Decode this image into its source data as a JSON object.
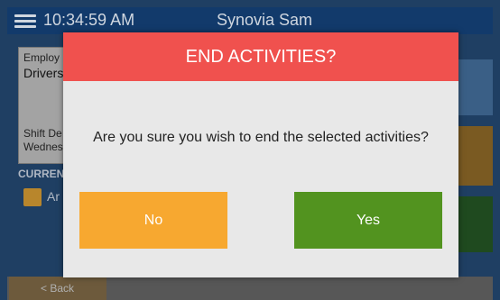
{
  "header": {
    "time": "10:34:59 AM",
    "user": "Synovia Sam"
  },
  "info_panel": {
    "employee_label": "Employ",
    "employee_value": "Drivers",
    "shift_label": "Shift De",
    "shift_value": "Wednes"
  },
  "current": {
    "label": "CURREN",
    "activity_text": "Ar"
  },
  "footer": {
    "back_label": "< Back"
  },
  "dialog": {
    "title": "END ACTIVITIES?",
    "message": "Are you sure you wish to end the selected activities?",
    "no_label": "No",
    "yes_label": "Yes"
  },
  "colors": {
    "dialog_header": "#f0514e",
    "no_button": "#f7a830",
    "yes_button": "#52931f",
    "app_background": "#1f3f63"
  },
  "icons": {
    "menu": "hamburger-menu-icon",
    "checkbox": "checkbox"
  }
}
